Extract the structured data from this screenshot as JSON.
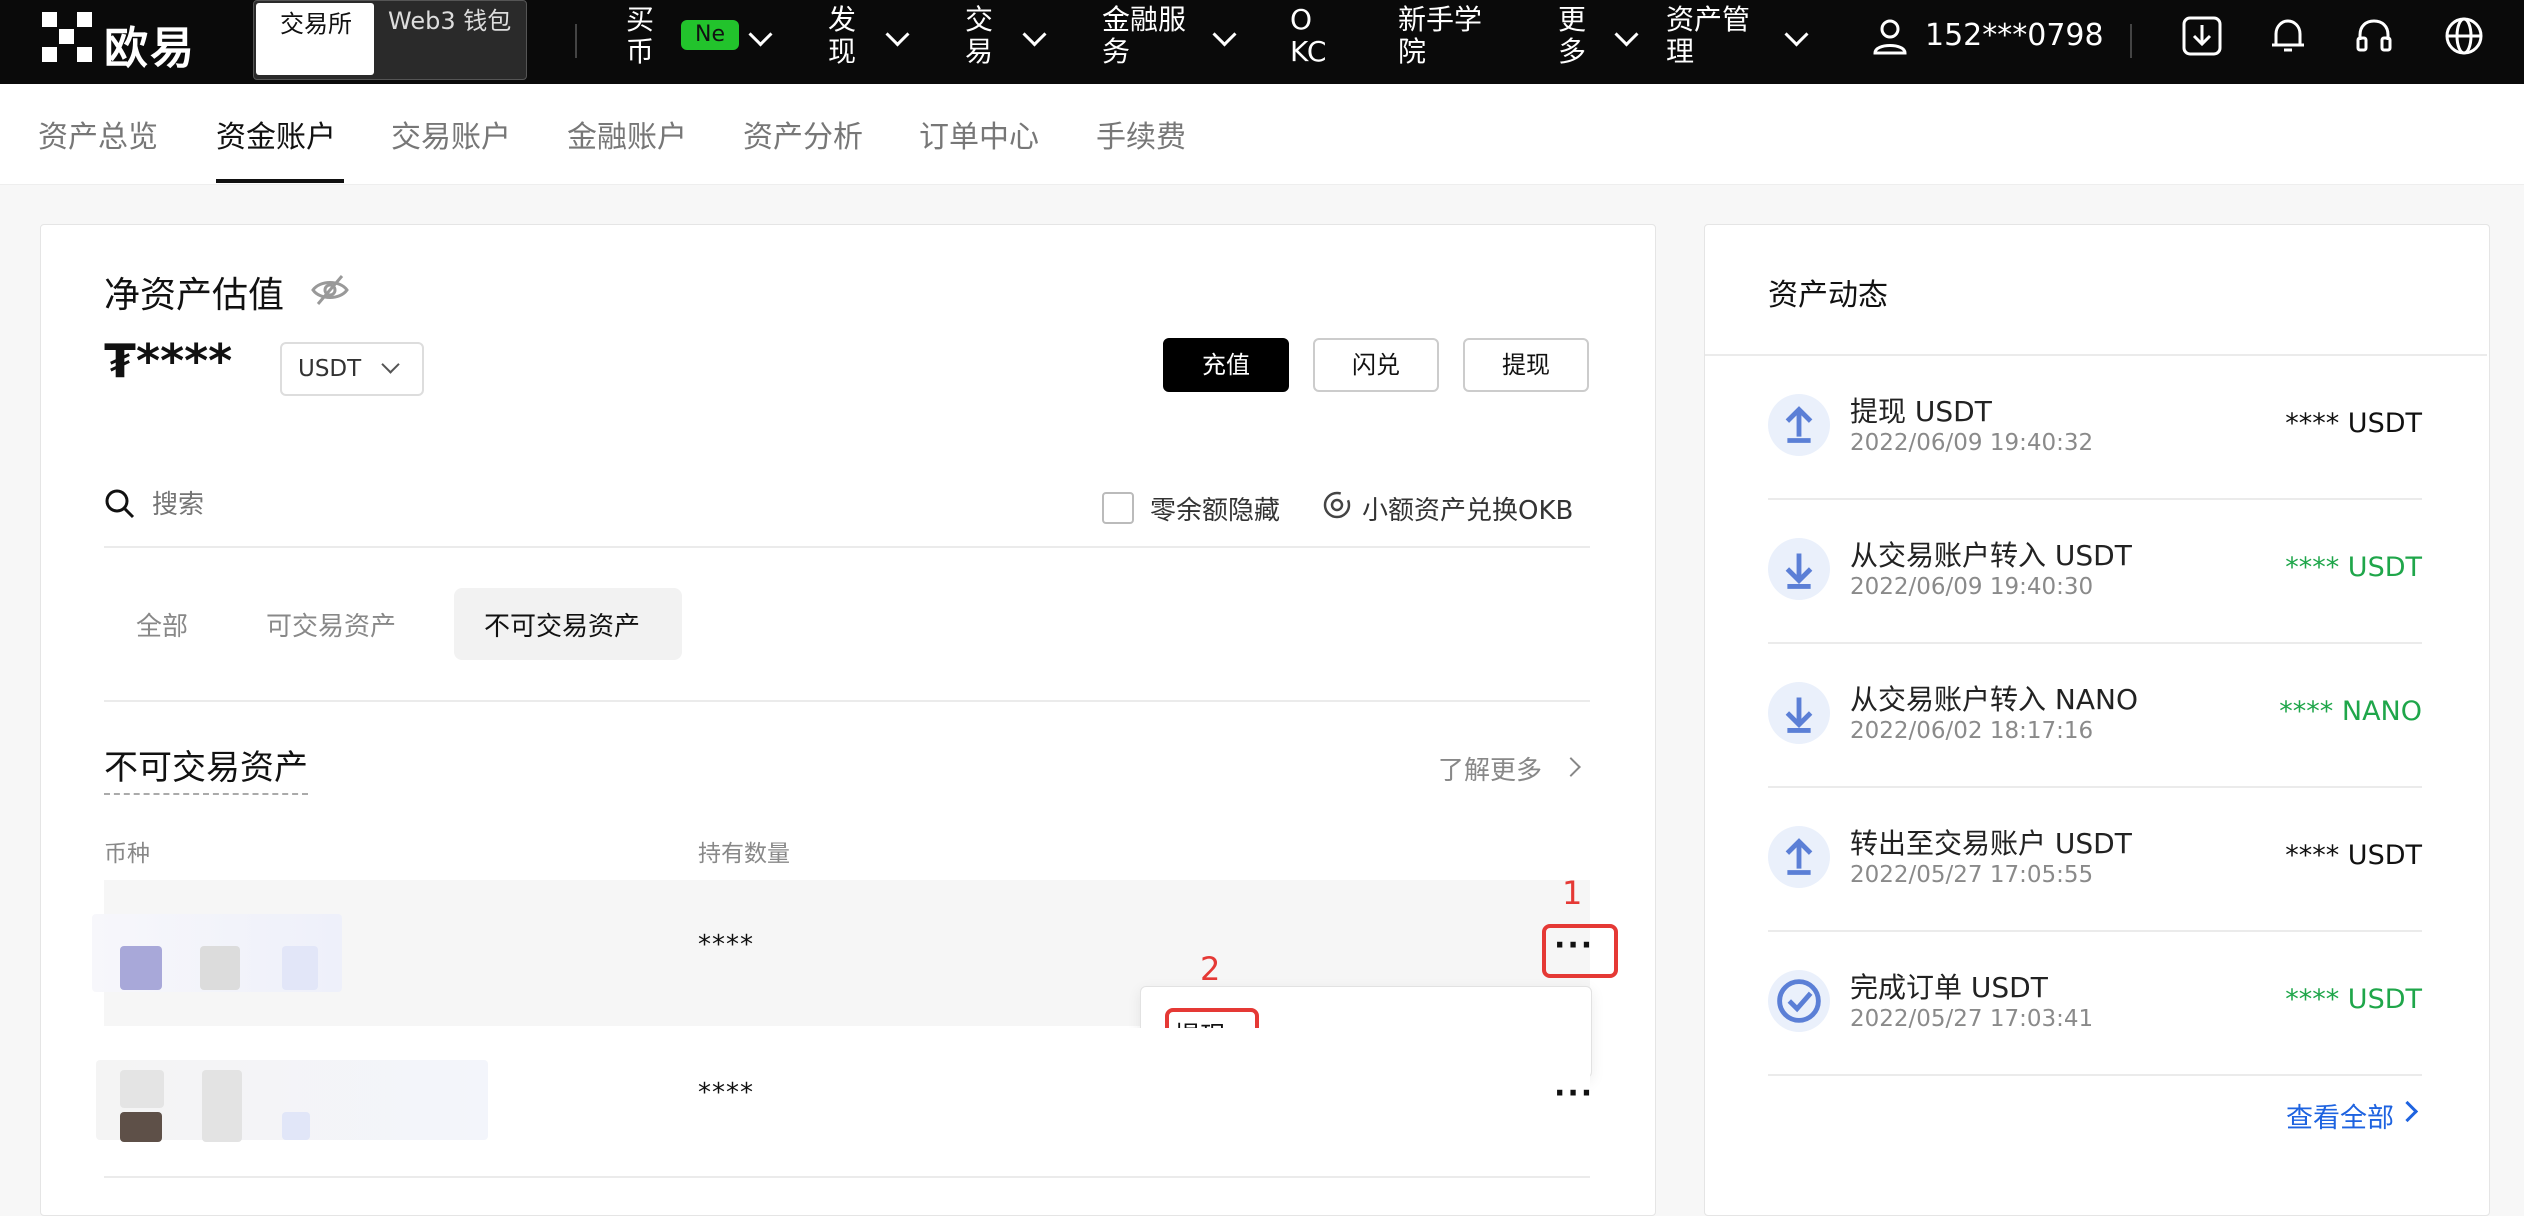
{
  "topnav": {
    "logo_text": "欧易",
    "switch_exchange": "交易所",
    "switch_web3": "Web3 钱包",
    "items": [
      {
        "label": "买币"
      },
      {
        "label": "发现"
      },
      {
        "label": "交易"
      },
      {
        "label": "金融服务"
      },
      {
        "label": "OKC"
      },
      {
        "label": "新手学院"
      },
      {
        "label": "更多"
      },
      {
        "label": "资产管理"
      }
    ],
    "badge": "Ne",
    "phone": "152***0798",
    "icons": [
      "download-icon",
      "bell-icon",
      "headset-icon",
      "globe-icon"
    ]
  },
  "subnav": {
    "tabs": [
      "资产总览",
      "资金账户",
      "交易账户",
      "金融账户",
      "资产分析",
      "订单中心",
      "手续费"
    ],
    "active": "资金账户"
  },
  "valuation": {
    "title": "净资产估值",
    "amount": "₮****",
    "currency": "USDT",
    "buttons": {
      "deposit": "充值",
      "convert": "闪兑",
      "withdraw": "提现"
    }
  },
  "search": {
    "placeholder": "搜索"
  },
  "filters": {
    "hide_zero": "零余额隐藏",
    "convert_small": "小额资产兑换OKB"
  },
  "asset_tabs": [
    "全部",
    "可交易资产",
    "不可交易资产"
  ],
  "asset_tab_active": "不可交易资产",
  "section": {
    "title": "不可交易资产",
    "learn_more": "了解更多",
    "col_coin": "币种",
    "col_amount": "持有数量"
  },
  "rows": [
    {
      "amount": "****"
    },
    {
      "amount": "****"
    }
  ],
  "more_menu": {
    "item": "提现"
  },
  "annotations": {
    "a1": "1",
    "a2": "2"
  },
  "activity": {
    "title": "资产动态",
    "items": [
      {
        "title": "提现 USDT",
        "time": "2022/06/09 19:40:32",
        "amount": "**** USDT",
        "icon": "arrow-up-icon",
        "color": "#111111"
      },
      {
        "title": "从交易账户转入 USDT",
        "time": "2022/06/09 19:40:30",
        "amount": "**** USDT",
        "icon": "arrow-down-icon",
        "color": "#1fa64a"
      },
      {
        "title": "从交易账户转入 NANO",
        "time": "2022/06/02 18:17:16",
        "amount": "**** NANO",
        "icon": "arrow-down-icon",
        "color": "#1fa64a"
      },
      {
        "title": "转出至交易账户 USDT",
        "time": "2022/05/27 17:05:55",
        "amount": "**** USDT",
        "icon": "arrow-up-icon",
        "color": "#111111"
      },
      {
        "title": "完成订单 USDT",
        "time": "2022/05/27 17:03:41",
        "amount": "**** USDT",
        "icon": "order-check-icon",
        "color": "#1fa64a"
      }
    ],
    "view_all": "查看全部"
  }
}
